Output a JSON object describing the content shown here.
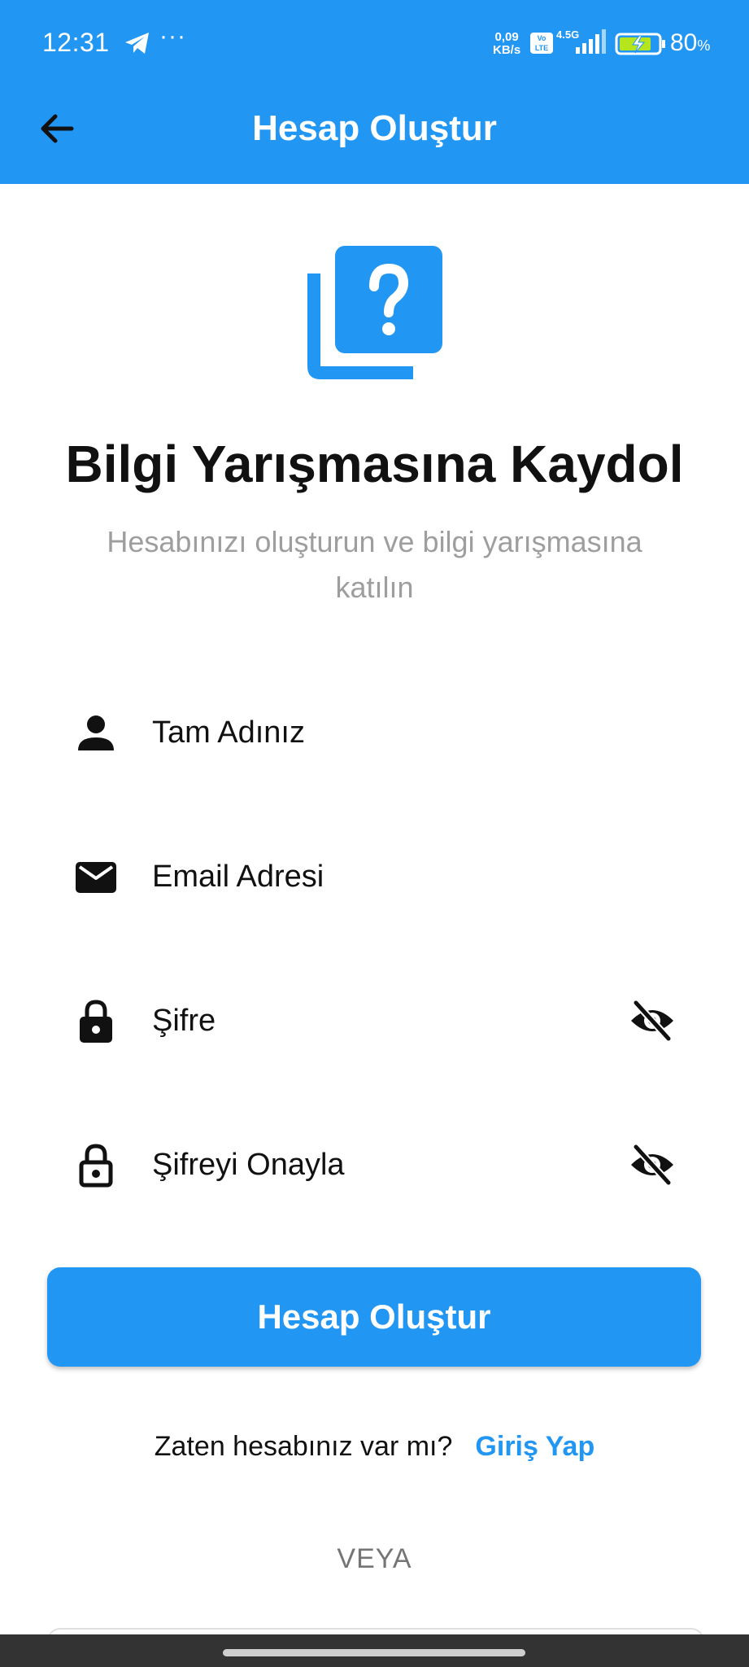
{
  "status_bar": {
    "time": "12:31",
    "dots": "···",
    "net_speed_value": "0,09",
    "net_speed_unit": "KB/s",
    "volte_top": "Vo",
    "volte_bottom": "LTE",
    "network_type": "4.5G",
    "battery_value": "80",
    "battery_unit": "%"
  },
  "appbar": {
    "title": "Hesap Oluştur",
    "color": "#2196F3"
  },
  "hero": {
    "icon": "quiz-icon",
    "heading": "Bilgi Yarışmasına Kaydol",
    "subtitle": "Hesabınızı oluşturun ve bilgi yarışmasına katılın"
  },
  "form": {
    "fields": [
      {
        "label": "Tam Adınız",
        "icon": "person-icon"
      },
      {
        "label": "Email Adresi",
        "icon": "email-icon"
      },
      {
        "label": "Şifre",
        "icon": "lock-icon",
        "toggle": "visibility-off-icon"
      },
      {
        "label": "Şifreyi Onayla",
        "icon": "lock-outline-icon",
        "toggle": "visibility-off-icon"
      }
    ],
    "submit_label": "Hesap Oluştur"
  },
  "login_prompt": {
    "question": "Zaten hesabınız var mı?",
    "link": "Giriş Yap"
  },
  "divider_text": "VEYA",
  "colors": {
    "primary": "#2196F3",
    "subtitle": "#9e9e9e",
    "text": "#111111"
  }
}
